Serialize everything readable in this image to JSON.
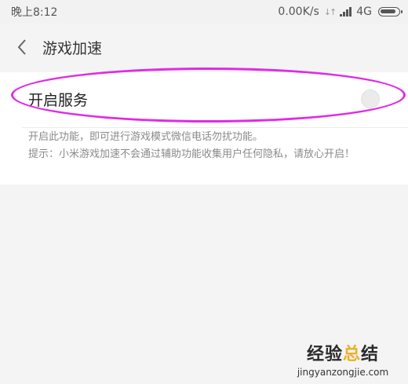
{
  "status_bar": {
    "time": "晚上8:12",
    "speed": "0.00K/s",
    "network": "4G",
    "battery_level": 0.85
  },
  "header": {
    "back_icon": "chevron-left-icon",
    "title": "游戏加速"
  },
  "setting": {
    "label": "开启服务",
    "enabled": false
  },
  "description": {
    "line1": "开启此功能，即可进行游戏模式微信电话勿扰功能。",
    "line2": "提示：小米游戏加速不会通过辅助功能收集用户任何隐私，请放心开启！"
  },
  "watermark": {
    "brand_part1": "经验",
    "brand_part2": "总",
    "brand_part3": "结",
    "url": "jingyanzongjie.com"
  },
  "colors": {
    "highlight": "#e02be6",
    "accent": "#e8b12a"
  }
}
